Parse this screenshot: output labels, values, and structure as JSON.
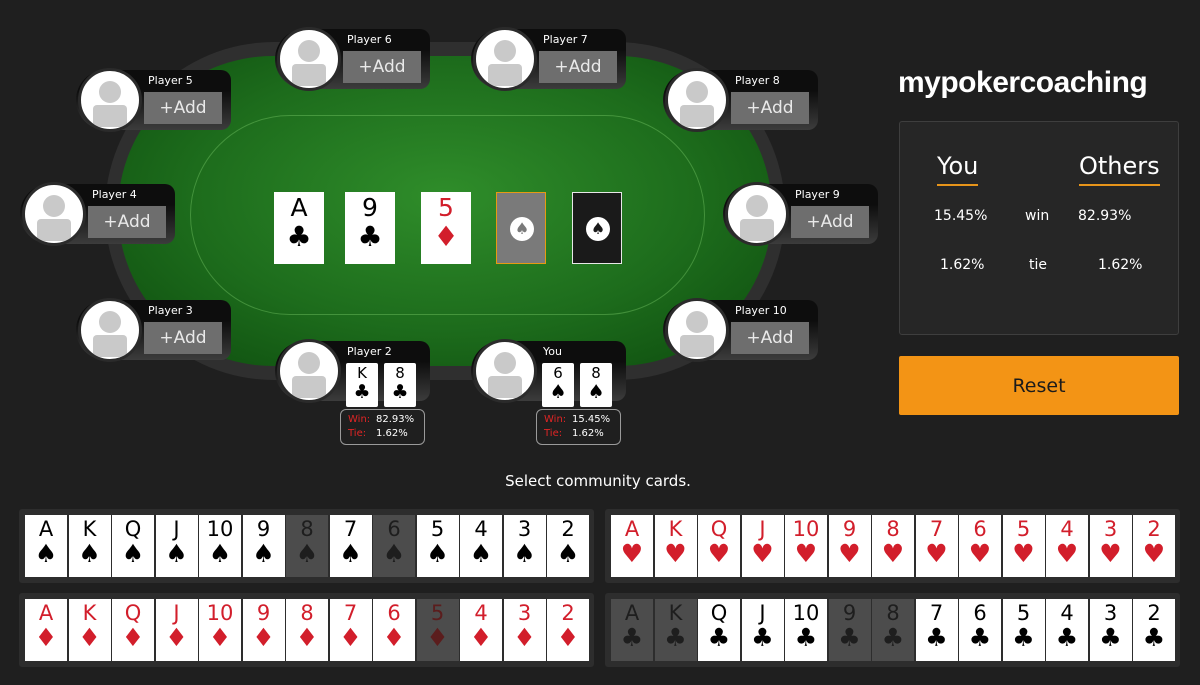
{
  "brand": "mypokercoaching",
  "seats": [
    {
      "name": "Player 5",
      "add": "+Add"
    },
    {
      "name": "Player 6",
      "add": "+Add"
    },
    {
      "name": "Player 7",
      "add": "+Add"
    },
    {
      "name": "Player 8",
      "add": "+Add"
    },
    {
      "name": "Player 4",
      "add": "+Add"
    },
    {
      "name": "Player 9",
      "add": "+Add"
    },
    {
      "name": "Player 3",
      "add": "+Add"
    },
    {
      "name": "Player 10",
      "add": "+Add"
    },
    {
      "name": "Player 2"
    },
    {
      "name": "You"
    }
  ],
  "hands": {
    "player2": {
      "cards": [
        {
          "rank": "K",
          "suit": "♣"
        },
        {
          "rank": "8",
          "suit": "♣"
        }
      ],
      "win_label": "Win:",
      "win": "82.93%",
      "tie_label": "Tie:",
      "tie": "1.62%"
    },
    "you": {
      "cards": [
        {
          "rank": "6",
          "suit": "♠"
        },
        {
          "rank": "8",
          "suit": "♠"
        }
      ],
      "win_label": "Win:",
      "win": "15.45%",
      "tie_label": "Tie:",
      "tie": "1.62%"
    }
  },
  "board": [
    {
      "rank": "A",
      "suit": "♣",
      "color": "black"
    },
    {
      "rank": "9",
      "suit": "♣",
      "color": "black"
    },
    {
      "rank": "5",
      "suit": "♦",
      "color": "red"
    },
    {
      "state": "empty-selected",
      "icon": "spade-logo-icon"
    },
    {
      "state": "empty",
      "icon": "spade-logo-icon"
    }
  ],
  "stats": {
    "you_header": "You",
    "others_header": "Others",
    "win_label": "win",
    "tie_label": "tie",
    "you_win": "15.45%",
    "others_win": "82.93%",
    "you_tie": "1.62%",
    "others_tie": "1.62%"
  },
  "reset_label": "Reset",
  "prompt": "Select community cards.",
  "ranks": [
    "A",
    "K",
    "Q",
    "J",
    "10",
    "9",
    "8",
    "7",
    "6",
    "5",
    "4",
    "3",
    "2"
  ],
  "deck": [
    {
      "suit": "spades",
      "symbol": "♠",
      "color": "black",
      "used": [
        "8",
        "6"
      ]
    },
    {
      "suit": "hearts",
      "symbol": "♥",
      "color": "red",
      "used": []
    },
    {
      "suit": "diamonds",
      "symbol": "♦",
      "color": "red",
      "used": [
        "5"
      ]
    },
    {
      "suit": "clubs",
      "symbol": "♣",
      "color": "black",
      "used": [
        "A",
        "K",
        "9",
        "8"
      ]
    }
  ],
  "colors": {
    "accent": "#f39415",
    "card_red": "#d21e2b",
    "felt": "#1d6c1c"
  }
}
